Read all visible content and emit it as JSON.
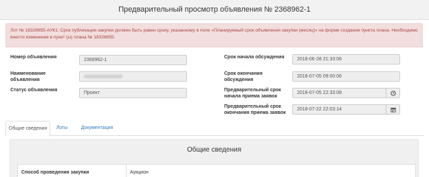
{
  "header": {
    "title": "Предварительный просмотр объявления № 2368962-1"
  },
  "alert": {
    "text": "Лот № 18326655-АУК1: Срок публикации закупки должен быть равен сроку, указанному в поле «Планируемый срок объявления закупки (месяц)» на форме создания пункта плана. Необходимо внести изменения в пункт (ы) плана № 18326655."
  },
  "left_fields": {
    "number_label": "Номер объявления",
    "number_value": "2368962-1",
    "name_label": "Наименование объявления",
    "status_label": "Статус объявления",
    "status_value": "Проект"
  },
  "right_fields": {
    "discussion_start_label": "Срок начала обсуждения",
    "discussion_start_value": "2018-06-28 21:33:06",
    "discussion_end_label": "Срок окончания обсуждения",
    "discussion_end_value": "2018-07-05 09:00:06",
    "prelim_start_label": "Предварительный срок начала приема заявок",
    "prelim_start_value": "2018-07-05 22:33:08",
    "prelim_end_label": "Предварительный срок окончания приема заявок",
    "prelim_end_value": "2018-07-22 22:03:14"
  },
  "icons": {
    "prelim_start_addon": "clock-icon",
    "prelim_end_addon": "calendar-icon"
  },
  "tabs": [
    {
      "label": "Общие сведения",
      "active": true
    },
    {
      "label": "Лоты",
      "active": false
    },
    {
      "label": "Документация",
      "active": false
    }
  ],
  "panel": {
    "title": "Общие сведения",
    "row_key": "Способ проведения закупки",
    "row_value": "Аукцион"
  },
  "colors": {
    "alert_bg": "#f2dede",
    "alert_text": "#a94442",
    "link": "#337ab7"
  }
}
